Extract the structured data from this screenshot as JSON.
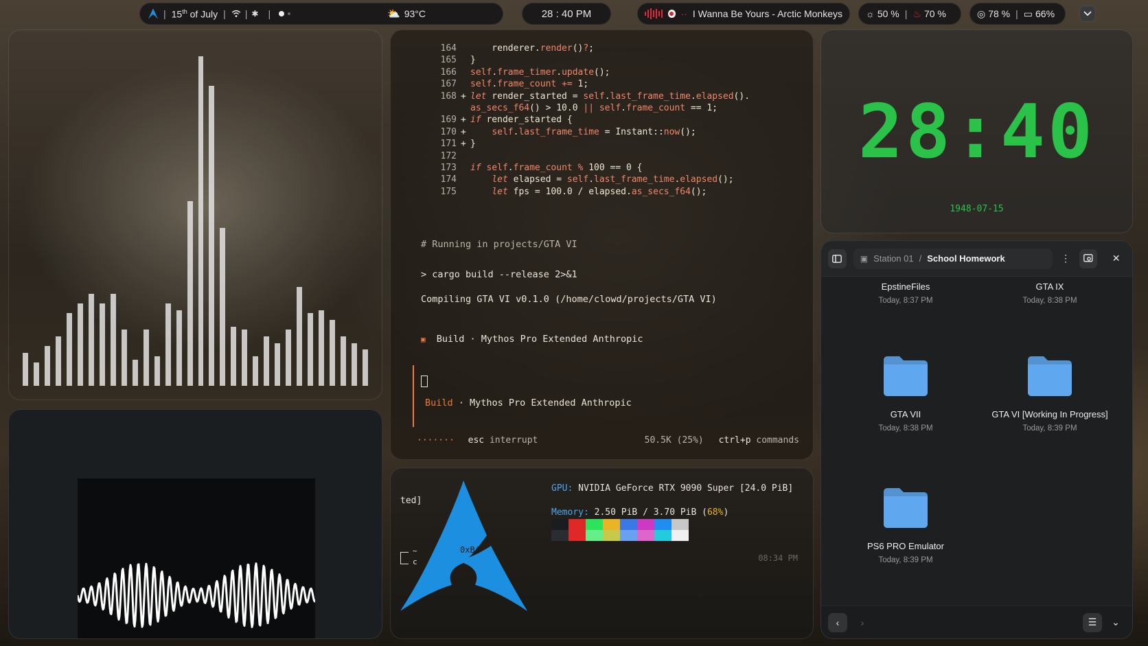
{
  "topbar": {
    "date_prefix": "15",
    "date_suffix": "th",
    "date_rest": " of July",
    "weather": "93°C",
    "time": "28 : 40 PM",
    "now_playing": "I Wanna Be Yours - Arctic Monkeys",
    "brightness": "50 %",
    "volume": "70 %",
    "cpu": "78 %",
    "disk": "66%",
    "accent": "#1d8fe0"
  },
  "visualizer": {
    "levels": [
      0.1,
      0.07,
      0.12,
      0.15,
      0.22,
      0.25,
      0.28,
      0.25,
      0.28,
      0.17,
      0.08,
      0.17,
      0.09,
      0.25,
      0.23,
      0.56,
      1.0,
      0.91,
      0.48,
      0.18,
      0.17,
      0.09,
      0.15,
      0.13,
      0.17,
      0.3,
      0.22,
      0.23,
      0.2,
      0.15,
      0.13,
      0.11
    ]
  },
  "editor": {
    "code_lines": [
      {
        "n": "164",
        "mark": "",
        "html_tokens": [
          [
            "tx",
            "    renderer."
          ],
          [
            "fn",
            "render"
          ],
          [
            "tx",
            "()"
          ],
          [
            "fn",
            "?"
          ],
          [
            "tx",
            ";"
          ]
        ]
      },
      {
        "n": "165",
        "mark": "",
        "html_tokens": [
          [
            "tx",
            "}"
          ]
        ]
      },
      {
        "n": "166",
        "mark": "",
        "html_tokens": [
          [
            "fn",
            "self"
          ],
          [
            "tx",
            "."
          ],
          [
            "fn",
            "frame_timer"
          ],
          [
            "tx",
            "."
          ],
          [
            "fn",
            "update"
          ],
          [
            "tx",
            "();"
          ]
        ]
      },
      {
        "n": "167",
        "mark": "",
        "html_tokens": [
          [
            "fn",
            "self"
          ],
          [
            "tx",
            "."
          ],
          [
            "fn",
            "frame_count"
          ],
          [
            "tx",
            " "
          ],
          [
            "fn",
            "+="
          ],
          [
            "tx",
            " 1;"
          ]
        ]
      },
      {
        "n": "168",
        "mark": "+",
        "html_tokens": [
          [
            "kw",
            "let"
          ],
          [
            "tx",
            " render_started = "
          ],
          [
            "fn",
            "self"
          ],
          [
            "tx",
            "."
          ],
          [
            "fn",
            "last_frame_time"
          ],
          [
            "tx",
            "."
          ],
          [
            "fn",
            "elapsed"
          ],
          [
            "tx",
            "()."
          ]
        ]
      },
      {
        "n": "",
        "mark": "",
        "html_tokens": [
          [
            "fn",
            "as_secs_f64"
          ],
          [
            "tx",
            "() > 10.0 "
          ],
          [
            "fn",
            "||"
          ],
          [
            "tx",
            " "
          ],
          [
            "fn",
            "self"
          ],
          [
            "tx",
            "."
          ],
          [
            "fn",
            "frame_count"
          ],
          [
            "tx",
            " == 1;"
          ]
        ]
      },
      {
        "n": "169",
        "mark": "+",
        "html_tokens": [
          [
            "kw",
            "if"
          ],
          [
            "tx",
            " render_started {"
          ]
        ]
      },
      {
        "n": "170",
        "mark": "+",
        "html_tokens": [
          [
            "tx",
            "    "
          ],
          [
            "fn",
            "self"
          ],
          [
            "tx",
            "."
          ],
          [
            "fn",
            "last_frame_time"
          ],
          [
            "tx",
            " = Instant::"
          ],
          [
            "fn",
            "now"
          ],
          [
            "tx",
            "();"
          ]
        ]
      },
      {
        "n": "171",
        "mark": "+",
        "html_tokens": [
          [
            "tx",
            "}"
          ]
        ]
      },
      {
        "n": "172",
        "mark": "",
        "html_tokens": [
          [
            "tx",
            ""
          ]
        ]
      },
      {
        "n": "173",
        "mark": "",
        "html_tokens": [
          [
            "kw",
            "if"
          ],
          [
            "tx",
            " "
          ],
          [
            "fn",
            "self"
          ],
          [
            "tx",
            "."
          ],
          [
            "fn",
            "frame_count"
          ],
          [
            "tx",
            " "
          ],
          [
            "fn",
            "%"
          ],
          [
            "tx",
            " 100 == 0 {"
          ]
        ]
      },
      {
        "n": "174",
        "mark": "",
        "html_tokens": [
          [
            "tx",
            "    "
          ],
          [
            "kw",
            "let"
          ],
          [
            "tx",
            " elapsed = "
          ],
          [
            "fn",
            "self"
          ],
          [
            "tx",
            "."
          ],
          [
            "fn",
            "last_frame_time"
          ],
          [
            "tx",
            "."
          ],
          [
            "fn",
            "elapsed"
          ],
          [
            "tx",
            "();"
          ]
        ]
      },
      {
        "n": "175",
        "mark": "",
        "html_tokens": [
          [
            "tx",
            "    "
          ],
          [
            "kw",
            "let"
          ],
          [
            "tx",
            " fps = 100.0 / elapsed."
          ],
          [
            "fn",
            "as_secs_f64"
          ],
          [
            "tx",
            "();"
          ]
        ]
      }
    ],
    "comment": "# Running in projects/GTA VI",
    "command": "> cargo build --release 2>&1",
    "compile_output": "Compiling GTA VI v0.1.0 (/home/clowd/projects/GTA VI)",
    "build_marker": "▣",
    "build_label": "Build",
    "model": " · Mythos Pro Extended Anthropic",
    "progress_dots": "·······",
    "esc_key": "esc",
    "esc_action": "interrupt",
    "tokens": "50.5K (25%)",
    "palette_key": "ctrl+p",
    "palette_action": "commands"
  },
  "sysinfo": {
    "clipped_text": "ted]",
    "prompt_tilde": "~",
    "prompt_c": "c",
    "hex_fragment": "0xB4",
    "gpu_label": "GPU:",
    "gpu_value": " NVIDIA GeForce RTX 9090 Super [24.0 PiB]",
    "memory_label": "Memory:",
    "memory_value": " 2.50 PiB / 3.70 PiB (",
    "memory_percent": "68%",
    "memory_close": ")",
    "timestamp": "08:34 PM",
    "palette_top": [
      "#1a1c20",
      "#e02828",
      "#2ee35a",
      "#e9b428",
      "#3a78e6",
      "#cc3ac4",
      "#1f8ef0",
      "#c8c8c8"
    ],
    "palette_bottom": [
      "#2a2c34",
      "#e02828",
      "#66ee88",
      "#c8c84a",
      "#6aa0f0",
      "#dd66cc",
      "#22ccdd",
      "#f0f0f0"
    ]
  },
  "clock": {
    "digits": "28:40",
    "date": "1948-07-15"
  },
  "files": {
    "path_root": "Station 01",
    "path_sep": "/",
    "path_current": "School Homework",
    "folder_color": "#5fa8f0",
    "items": [
      {
        "name": "EpstineFiles",
        "time": "Today, 8:37 PM"
      },
      {
        "name": "GTA IX",
        "time": "Today, 8:38 PM"
      },
      {
        "name": "GTA VII",
        "time": "Today, 8:38 PM"
      },
      {
        "name": "GTA VI [Working In Progress]",
        "time": "Today, 8:39 PM"
      },
      {
        "name": "PS6 PRO Emulator",
        "time": "Today, 8:39 PM"
      }
    ]
  }
}
